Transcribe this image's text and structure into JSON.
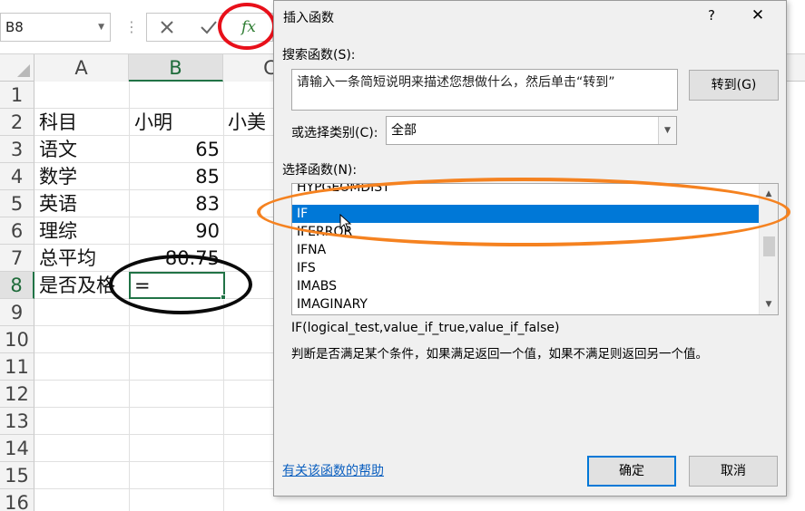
{
  "formula_bar": {
    "name_box": "B8",
    "cancel_icon": "close-icon",
    "enter_icon": "check-icon",
    "fx_label": "fx"
  },
  "sheet": {
    "columns": [
      "A",
      "B",
      "C"
    ],
    "rows": [
      "1",
      "2",
      "3",
      "4",
      "5",
      "6",
      "7",
      "8",
      "9",
      "10",
      "11",
      "12",
      "13",
      "14",
      "15",
      "16"
    ],
    "cells": {
      "a2": "科目",
      "b2": "小明",
      "c2": "小美",
      "a3": "语文",
      "b3": "65",
      "a4": "数学",
      "b4": "85",
      "a5": "英语",
      "b5": "83",
      "a6": "理综",
      "b6": "90",
      "a7": "总平均",
      "b7": "80.75",
      "a8": "是否及格",
      "b8": "="
    },
    "active_cell": "B8"
  },
  "dialog": {
    "title": "插入函数",
    "help_glyph": "?",
    "close_glyph": "✕",
    "search_label": "搜索函数(S):",
    "search_text": "请输入一条简短说明来描述您想做什么，然后单击“转到”",
    "goto_button": "转到(G)",
    "category_label": "或选择类别(C):",
    "category_value": "全部",
    "select_function_label": "选择函数(N):",
    "functions": [
      "HYPGEOMDIST",
      "IF",
      "IFERROR",
      "IFNA",
      "IFS",
      "IMABS",
      "IMAGINARY"
    ],
    "selected_function": "IF",
    "syntax": "IF(logical_test,value_if_true,value_if_false)",
    "description": "判断是否满足某个条件，如果满足返回一个值，如果不满足则返回另一个值。",
    "help_link": "有关该函数的帮助",
    "ok_button": "确定",
    "cancel_button": "取消"
  },
  "annotations": {
    "red_circle_color": "#e8101a",
    "black_ellipse_color": "#0a0a0a",
    "orange_ellipse_color": "#f58220"
  },
  "colors": {
    "excel_green": "#217346",
    "selection_blue": "#0078d7",
    "dialog_bg": "#f0f0f0"
  }
}
